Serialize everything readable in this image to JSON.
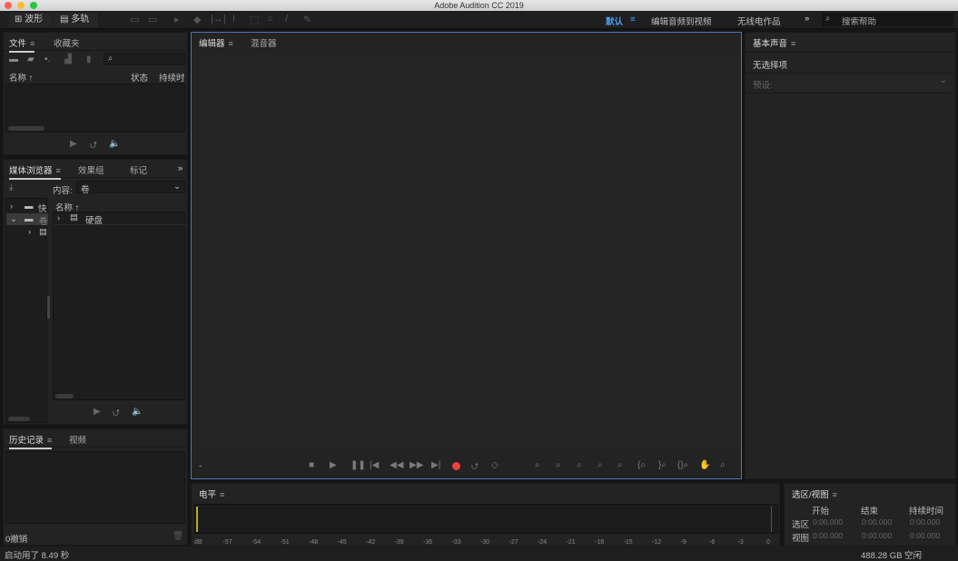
{
  "window": {
    "title": "Adobe Audition CC 2019"
  },
  "toolbar": {
    "waveform": "波形",
    "multitrack": "多轨",
    "workspaces": [
      "默认",
      "编辑音频到视频",
      "无线电作品"
    ],
    "more": "»",
    "search_placeholder": "搜索帮助",
    "accent": "#4b9cf0"
  },
  "files": {
    "tabs": [
      "文件",
      "收藏夹"
    ],
    "columns": [
      "名称 ↑",
      "状态",
      "持续时"
    ]
  },
  "media": {
    "tabs": [
      "媒体浏览器",
      "效果组",
      "标记"
    ],
    "more": "»",
    "content_label": "内容:",
    "content_value": "卷",
    "tree": [
      "快",
      "卷"
    ],
    "name_col": "名称 ↑",
    "items": [
      "硬盘"
    ]
  },
  "history": {
    "tabs": [
      "历史记录",
      "视频"
    ],
    "undo_count": "0撤销"
  },
  "editor": {
    "tabs": [
      "编辑器",
      "混音器"
    ],
    "time": "-"
  },
  "basic_sound": {
    "title": "基本声音",
    "no_selection": "无选择项",
    "preset_label": "预设:"
  },
  "levels": {
    "title": "电平",
    "ticks": [
      "dB",
      "-57",
      "-54",
      "-51",
      "-48",
      "-45",
      "-42",
      "-39",
      "-36",
      "-33",
      "-30",
      "-27",
      "-24",
      "-21",
      "-18",
      "-15",
      "-12",
      "-9",
      "-6",
      "-3",
      "0"
    ]
  },
  "selection": {
    "title": "选区/视图",
    "headers": [
      "开始",
      "结束",
      "持续时间"
    ],
    "rows": [
      {
        "label": "选区",
        "values": [
          "0:00.000",
          "0:00.000",
          "0:00.000"
        ]
      },
      {
        "label": "视图",
        "values": [
          "0:00.000",
          "0:00.000",
          "0:00.000"
        ]
      }
    ]
  },
  "status": {
    "startup": "启动用了 8.49 秒",
    "free_space": "488.28 GB 空闲"
  }
}
